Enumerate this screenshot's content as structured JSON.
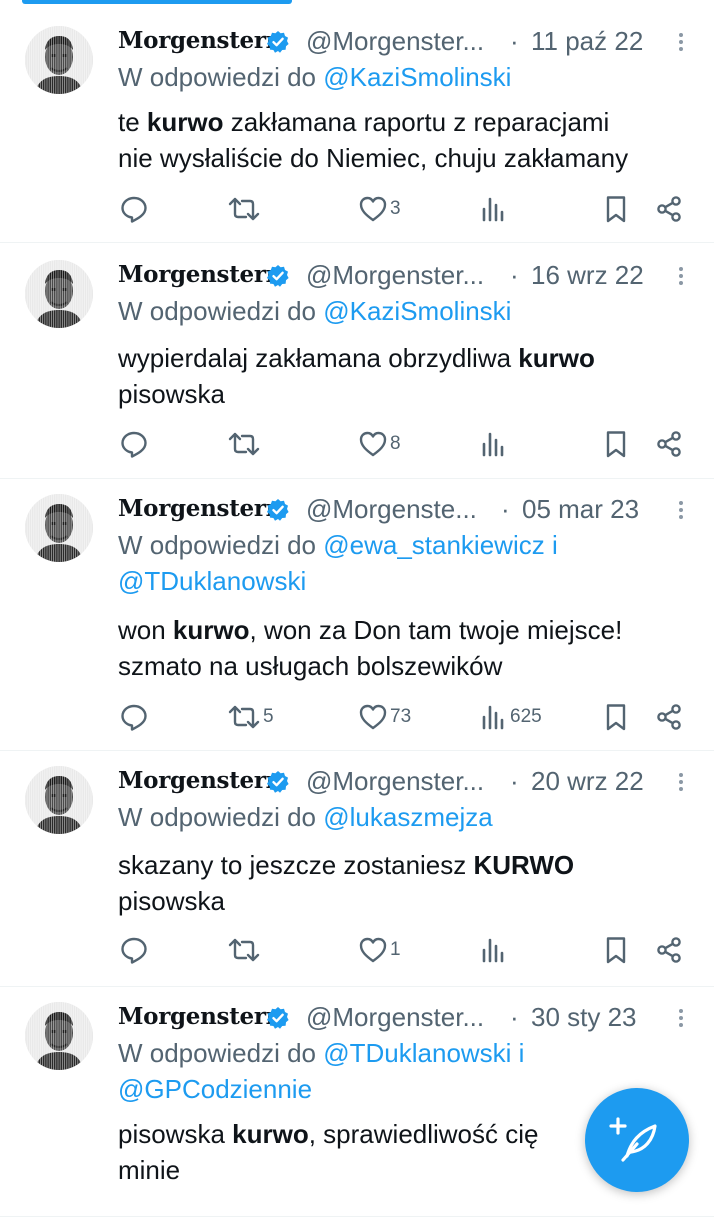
{
  "tweets": [
    {
      "name": "Morgenstern",
      "handle": "@Morgenster...",
      "date": "11 paź 22",
      "reply_prefix": "W odpowiedzi do",
      "mentions": [
        "@KaziSmolinski"
      ],
      "text": [
        [
          {
            "t": "te "
          },
          {
            "t": "kurwo",
            "b": true
          },
          {
            "t": " zakłamana raportu z reparacjami"
          }
        ],
        [
          {
            "t": "nie wysłaliście do Niemiec, chuju zakłamany"
          }
        ]
      ],
      "replies": "",
      "retweets": "",
      "likes": "3",
      "views": ""
    },
    {
      "name": "Morgenstern",
      "handle": "@Morgenster...",
      "date": "16 wrz 22",
      "reply_prefix": "W odpowiedzi do",
      "mentions": [
        "@KaziSmolinski"
      ],
      "text": [
        [
          {
            "t": "wypierdalaj zakłamana obrzydliwa "
          },
          {
            "t": "kurwo",
            "b": true
          }
        ],
        [
          {
            "t": "pisowska"
          }
        ]
      ],
      "replies": "",
      "retweets": "",
      "likes": "8",
      "views": ""
    },
    {
      "name": "Morgenstern",
      "handle": "@Morgenste...",
      "date": "05 mar 23",
      "reply_prefix": "W odpowiedzi do",
      "mentions": [
        "@ewa_stankiewicz i",
        "@TDuklanowski"
      ],
      "text": [
        [
          {
            "t": "won "
          },
          {
            "t": "kurwo",
            "b": true
          },
          {
            "t": ", won za Don tam twoje miejsce!"
          }
        ],
        [
          {
            "t": "szmato na usługach bolszewików"
          }
        ]
      ],
      "replies": "",
      "retweets": "5",
      "likes": "73",
      "views": "625"
    },
    {
      "name": "Morgenstern",
      "handle": "@Morgenster...",
      "date": "20 wrz 22",
      "reply_prefix": "W odpowiedzi do",
      "mentions": [
        "@lukaszmejza"
      ],
      "text": [
        [
          {
            "t": "skazany to jeszcze zostaniesz "
          },
          {
            "t": "KURWO",
            "b": true
          }
        ],
        [
          {
            "t": "pisowska"
          }
        ]
      ],
      "replies": "",
      "retweets": "",
      "likes": "1",
      "views": ""
    },
    {
      "name": "Morgenstern",
      "handle": "@Morgenster...",
      "date": "30 sty 23",
      "reply_prefix": "W odpowiedzi do",
      "mentions": [
        "@TDuklanowski i",
        "@GPCodziennie"
      ],
      "text": [
        [
          {
            "t": "pisowska "
          },
          {
            "t": "kurwo",
            "b": true
          },
          {
            "t": ", sprawiedliwość cię"
          }
        ],
        [
          {
            "t": "minie"
          }
        ]
      ],
      "replies": "",
      "retweets": "",
      "likes": "",
      "views": ""
    }
  ],
  "icons": {
    "reply": "reply-icon",
    "retweet": "retweet-icon",
    "like": "heart-icon",
    "views": "views-icon",
    "bookmark": "bookmark-icon",
    "share": "share-icon",
    "more": "more-icon",
    "verified": "verified-badge-icon",
    "compose": "compose-tweet-icon"
  },
  "colors": {
    "accent": "#1d9bf0",
    "secondary_text": "#536471",
    "primary_text": "#0f1419"
  }
}
